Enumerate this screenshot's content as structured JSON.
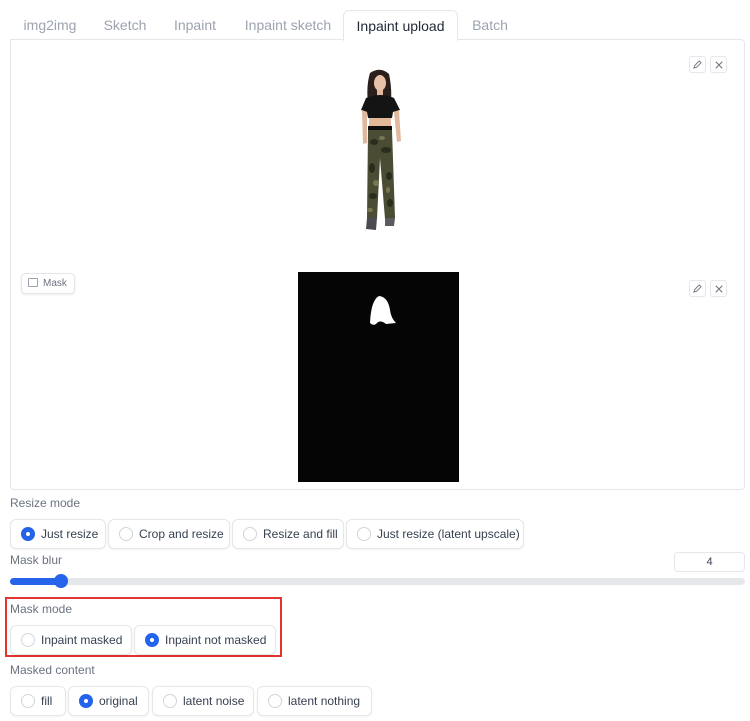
{
  "tabs": [
    {
      "label": "img2img",
      "active": false
    },
    {
      "label": "Sketch",
      "active": false
    },
    {
      "label": "Inpaint",
      "active": false
    },
    {
      "label": "Inpaint sketch",
      "active": false
    },
    {
      "label": "Inpaint upload",
      "active": true
    },
    {
      "label": "Batch",
      "active": false
    }
  ],
  "image_panel": {
    "mask_label": "Mask",
    "edit_icon": "pencil-icon",
    "clear_icon": "close-icon"
  },
  "resize_mode": {
    "label": "Resize mode",
    "options": [
      "Just resize",
      "Crop and resize",
      "Resize and fill",
      "Just resize (latent upscale)"
    ],
    "selected": "Just resize"
  },
  "mask_blur": {
    "label": "Mask blur",
    "value": "4",
    "fraction": 0.07
  },
  "mask_mode": {
    "label": "Mask mode",
    "options": [
      "Inpaint masked",
      "Inpaint not masked"
    ],
    "selected": "Inpaint not masked"
  },
  "masked_content": {
    "label": "Masked content",
    "options": [
      "fill",
      "original",
      "latent noise",
      "latent nothing"
    ],
    "selected": "original"
  },
  "colors": {
    "accent": "#2563eb",
    "highlight": "#e3342f",
    "mask_bg": "#050505"
  }
}
